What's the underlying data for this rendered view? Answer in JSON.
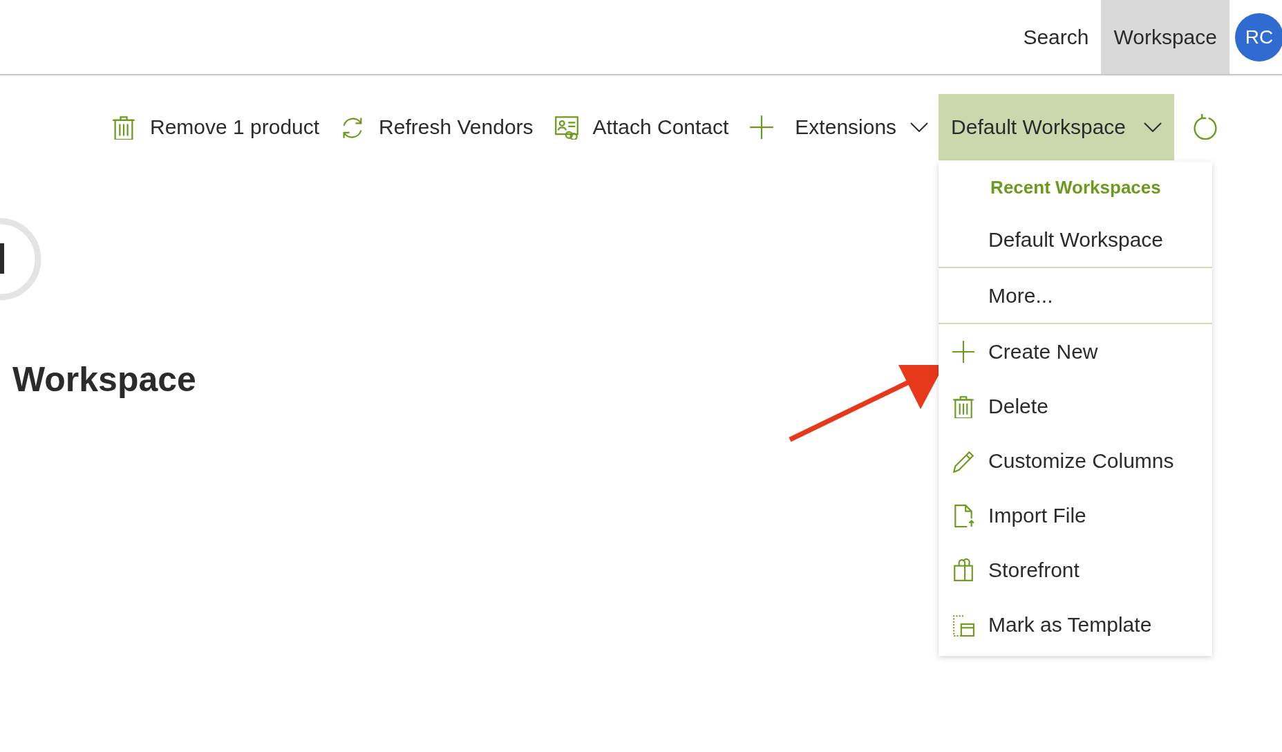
{
  "top_nav": {
    "items": [
      {
        "label": "Search",
        "selected": false
      },
      {
        "label": "Workspace",
        "selected": true
      }
    ],
    "avatar": {
      "initials": "RC"
    }
  },
  "toolbar": {
    "items": [
      {
        "kind": "trash",
        "label": "Remove 1 product"
      },
      {
        "kind": "refresh",
        "label": "Refresh Vendors"
      },
      {
        "kind": "contact",
        "label": "Attach Contact"
      },
      {
        "kind": "add"
      },
      {
        "kind": "dropdown",
        "label": "Extensions"
      }
    ],
    "workspace_selector": {
      "label": "Default Workspace",
      "expanded": true
    },
    "reload": {
      "kind": "reload"
    }
  },
  "workspace_menu": {
    "heading": "Recent Workspaces",
    "groups": [
      [
        {
          "kind": "plain",
          "label": "Default Workspace"
        }
      ],
      [
        {
          "kind": "plain",
          "label": "More..."
        }
      ],
      [
        {
          "kind": "add",
          "label": "Create New"
        },
        {
          "kind": "trash",
          "label": "Delete"
        },
        {
          "kind": "pencil",
          "label": "Customize Columns"
        },
        {
          "kind": "file",
          "label": "Import File"
        },
        {
          "kind": "bag",
          "label": "Storefront"
        },
        {
          "kind": "template",
          "label": "Mark as Template"
        }
      ]
    ]
  },
  "page": {
    "heading": "Workspace"
  }
}
